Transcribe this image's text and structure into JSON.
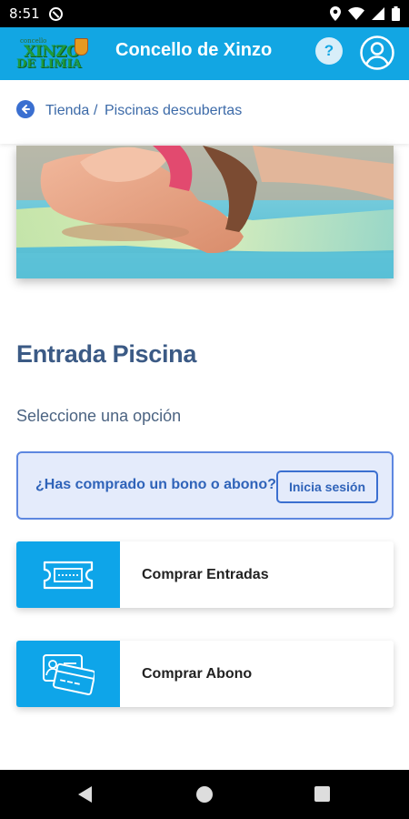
{
  "status_bar": {
    "time": "8:51"
  },
  "app_bar": {
    "logo": {
      "line1": "concello",
      "line2": "XINZO",
      "line3": "DE LIMIA"
    },
    "title": "Concello de Xinzo",
    "help_label": "?"
  },
  "breadcrumb": {
    "items": [
      "Tienda",
      "Piscinas descubertas"
    ],
    "separator": "/"
  },
  "main": {
    "heading": "Entrada Piscina",
    "subheading": "Seleccione una opción",
    "login_prompt": {
      "text": "¿Has comprado un bono o abono?",
      "button": "Inicia sesión"
    },
    "options": [
      {
        "label": "Comprar Entradas",
        "icon": "ticket-icon"
      },
      {
        "label": "Comprar Abono",
        "icon": "id-cards-icon"
      }
    ]
  },
  "colors": {
    "primary": "#12a6e3",
    "heading": "#3b5a85",
    "link": "#3c6aa8",
    "info_bg": "#e4ebfb",
    "info_border": "#5d87e0"
  }
}
